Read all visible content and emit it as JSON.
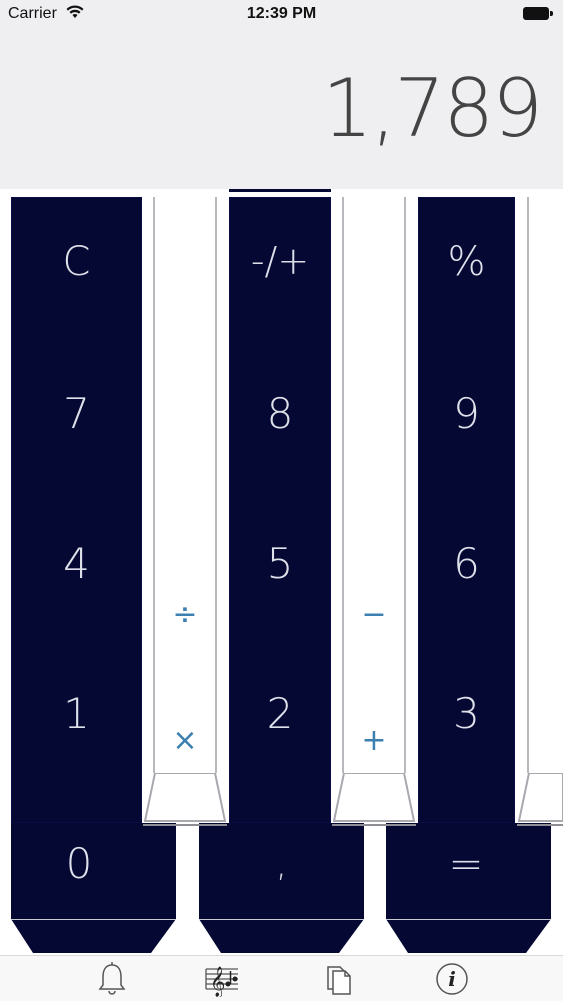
{
  "status_bar": {
    "carrier": "Carrier",
    "time": "12:39 PM"
  },
  "display": {
    "value": "1,789"
  },
  "keys": {
    "clear": "C",
    "negate": "-/+",
    "percent": "%",
    "seven": "7",
    "eight": "8",
    "nine": "9",
    "four": "4",
    "five": "5",
    "six": "6",
    "one": "1",
    "two": "2",
    "three": "3",
    "zero": "0",
    "decimal": ",",
    "equals": "="
  },
  "operators": {
    "divide": "÷",
    "multiply": "×",
    "minus": "−",
    "plus": "+"
  },
  "tabbar": {
    "items": [
      "bell-icon",
      "music-score-icon",
      "documents-icon",
      "info-icon"
    ]
  },
  "colors": {
    "key_dark": "#050833",
    "operator_blue": "#3c7fb1",
    "display_bg": "#efeff1"
  }
}
